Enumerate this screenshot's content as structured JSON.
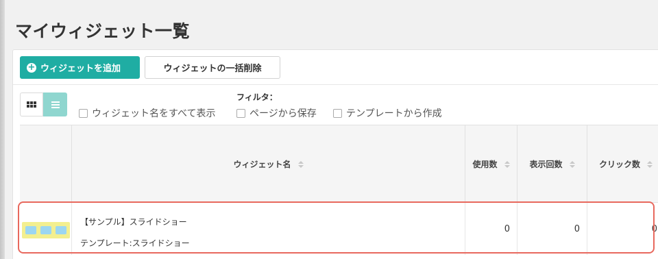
{
  "page": {
    "title": "マイウィジェット一覧"
  },
  "toolbar": {
    "add_label": "ウィジェットを追加",
    "bulk_delete_label": "ウィジェットの一括削除"
  },
  "filter": {
    "label": "フィルタ：",
    "options": [
      {
        "label": "ウィジェット名をすべて表示",
        "checked": false
      },
      {
        "label": "ページから保存",
        "checked": false
      },
      {
        "label": "テンプレートから作成",
        "checked": false
      }
    ]
  },
  "view_toggle": {
    "active": "list",
    "icons": [
      "grid-icon",
      "list-icon"
    ]
  },
  "table": {
    "columns": [
      "",
      "ウィジェット名",
      "使用数",
      "表示回数",
      "クリック数"
    ],
    "rows": [
      {
        "name": "【サンプル】スライドショー",
        "template": "テンプレート:スライドショー",
        "usage": "0",
        "views": "0",
        "clicks": "0"
      }
    ]
  },
  "colors": {
    "accent": "#1fada3",
    "list_toggle": "#8fd6cf",
    "highlight": "#e8685d"
  }
}
